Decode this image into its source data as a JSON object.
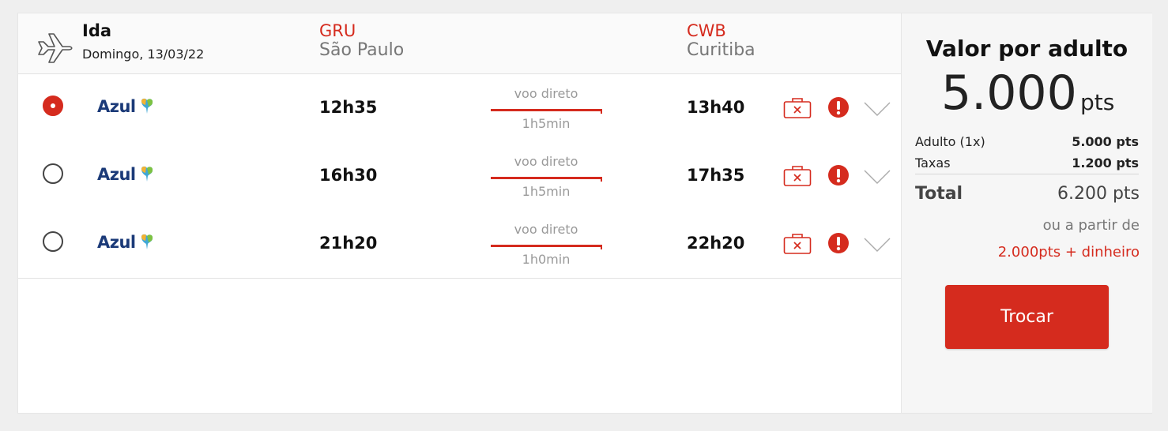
{
  "flight": {
    "direction": "Ida",
    "date": "Domingo, 13/03/22",
    "origin": {
      "code": "GRU",
      "city": "São Paulo"
    },
    "destination": {
      "code": "CWB",
      "city": "Curitiba"
    }
  },
  "flights": [
    {
      "selected": true,
      "airline": "Azul",
      "departure": "12h35",
      "stop": "voo direto",
      "duration": "1h5min",
      "arrival": "13h40"
    },
    {
      "selected": false,
      "airline": "Azul",
      "departure": "16h30",
      "stop": "voo direto",
      "duration": "1h5min",
      "arrival": "17h35"
    },
    {
      "selected": false,
      "airline": "Azul",
      "departure": "21h20",
      "stop": "voo direto",
      "duration": "1h0min",
      "arrival": "22h20"
    }
  ],
  "icons": {
    "plane": "plane-icon",
    "bag": "no-baggage-icon",
    "alert": "alert-icon",
    "expand": "chevron-down-icon"
  },
  "summary": {
    "title": "Valor por adulto",
    "price": "5.000",
    "price_unit": "pts",
    "items": [
      {
        "label": "Adulto (1x)",
        "value": "5.000 pts"
      },
      {
        "label": "Taxas",
        "value": "1.200 pts"
      }
    ],
    "total_label": "Total",
    "total_value": "6.200 pts",
    "alt_prefix": "ou a partir de",
    "alt_price": "2.000pts + dinheiro",
    "button": "Trocar"
  },
  "colors": {
    "accent": "#d52b1e",
    "airline_blue": "#1b3a78"
  }
}
